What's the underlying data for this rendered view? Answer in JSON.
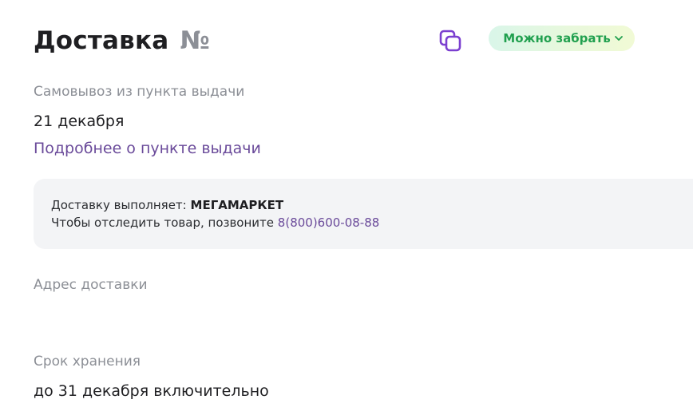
{
  "header": {
    "title": "Доставка",
    "number_sign": "№",
    "copy_icon": "copy-icon",
    "status": {
      "label": "Можно забрать",
      "icon": "chevron-down-icon",
      "color": "#21a04f"
    }
  },
  "pickup": {
    "label": "Самовывоз из пункта выдачи",
    "date": "21 декабря",
    "details_link": "Подробнее о пункте выдачи"
  },
  "info": {
    "delivery_prefix": "Доставку выполняет:",
    "carrier": "МЕГАМАРКЕТ",
    "track_prefix": "Чтобы отследить товар, позвоните",
    "phone": "8(800)600-08-88"
  },
  "address": {
    "label": "Адрес доставки",
    "value": ""
  },
  "storage": {
    "label": "Срок хранения",
    "value": "до 31 декабря включительно"
  },
  "colors": {
    "accent": "#6a4a9a",
    "muted": "#8c8f96",
    "text": "#1f1f22",
    "badge_text": "#21a04f",
    "panel": "#f3f4f6"
  }
}
